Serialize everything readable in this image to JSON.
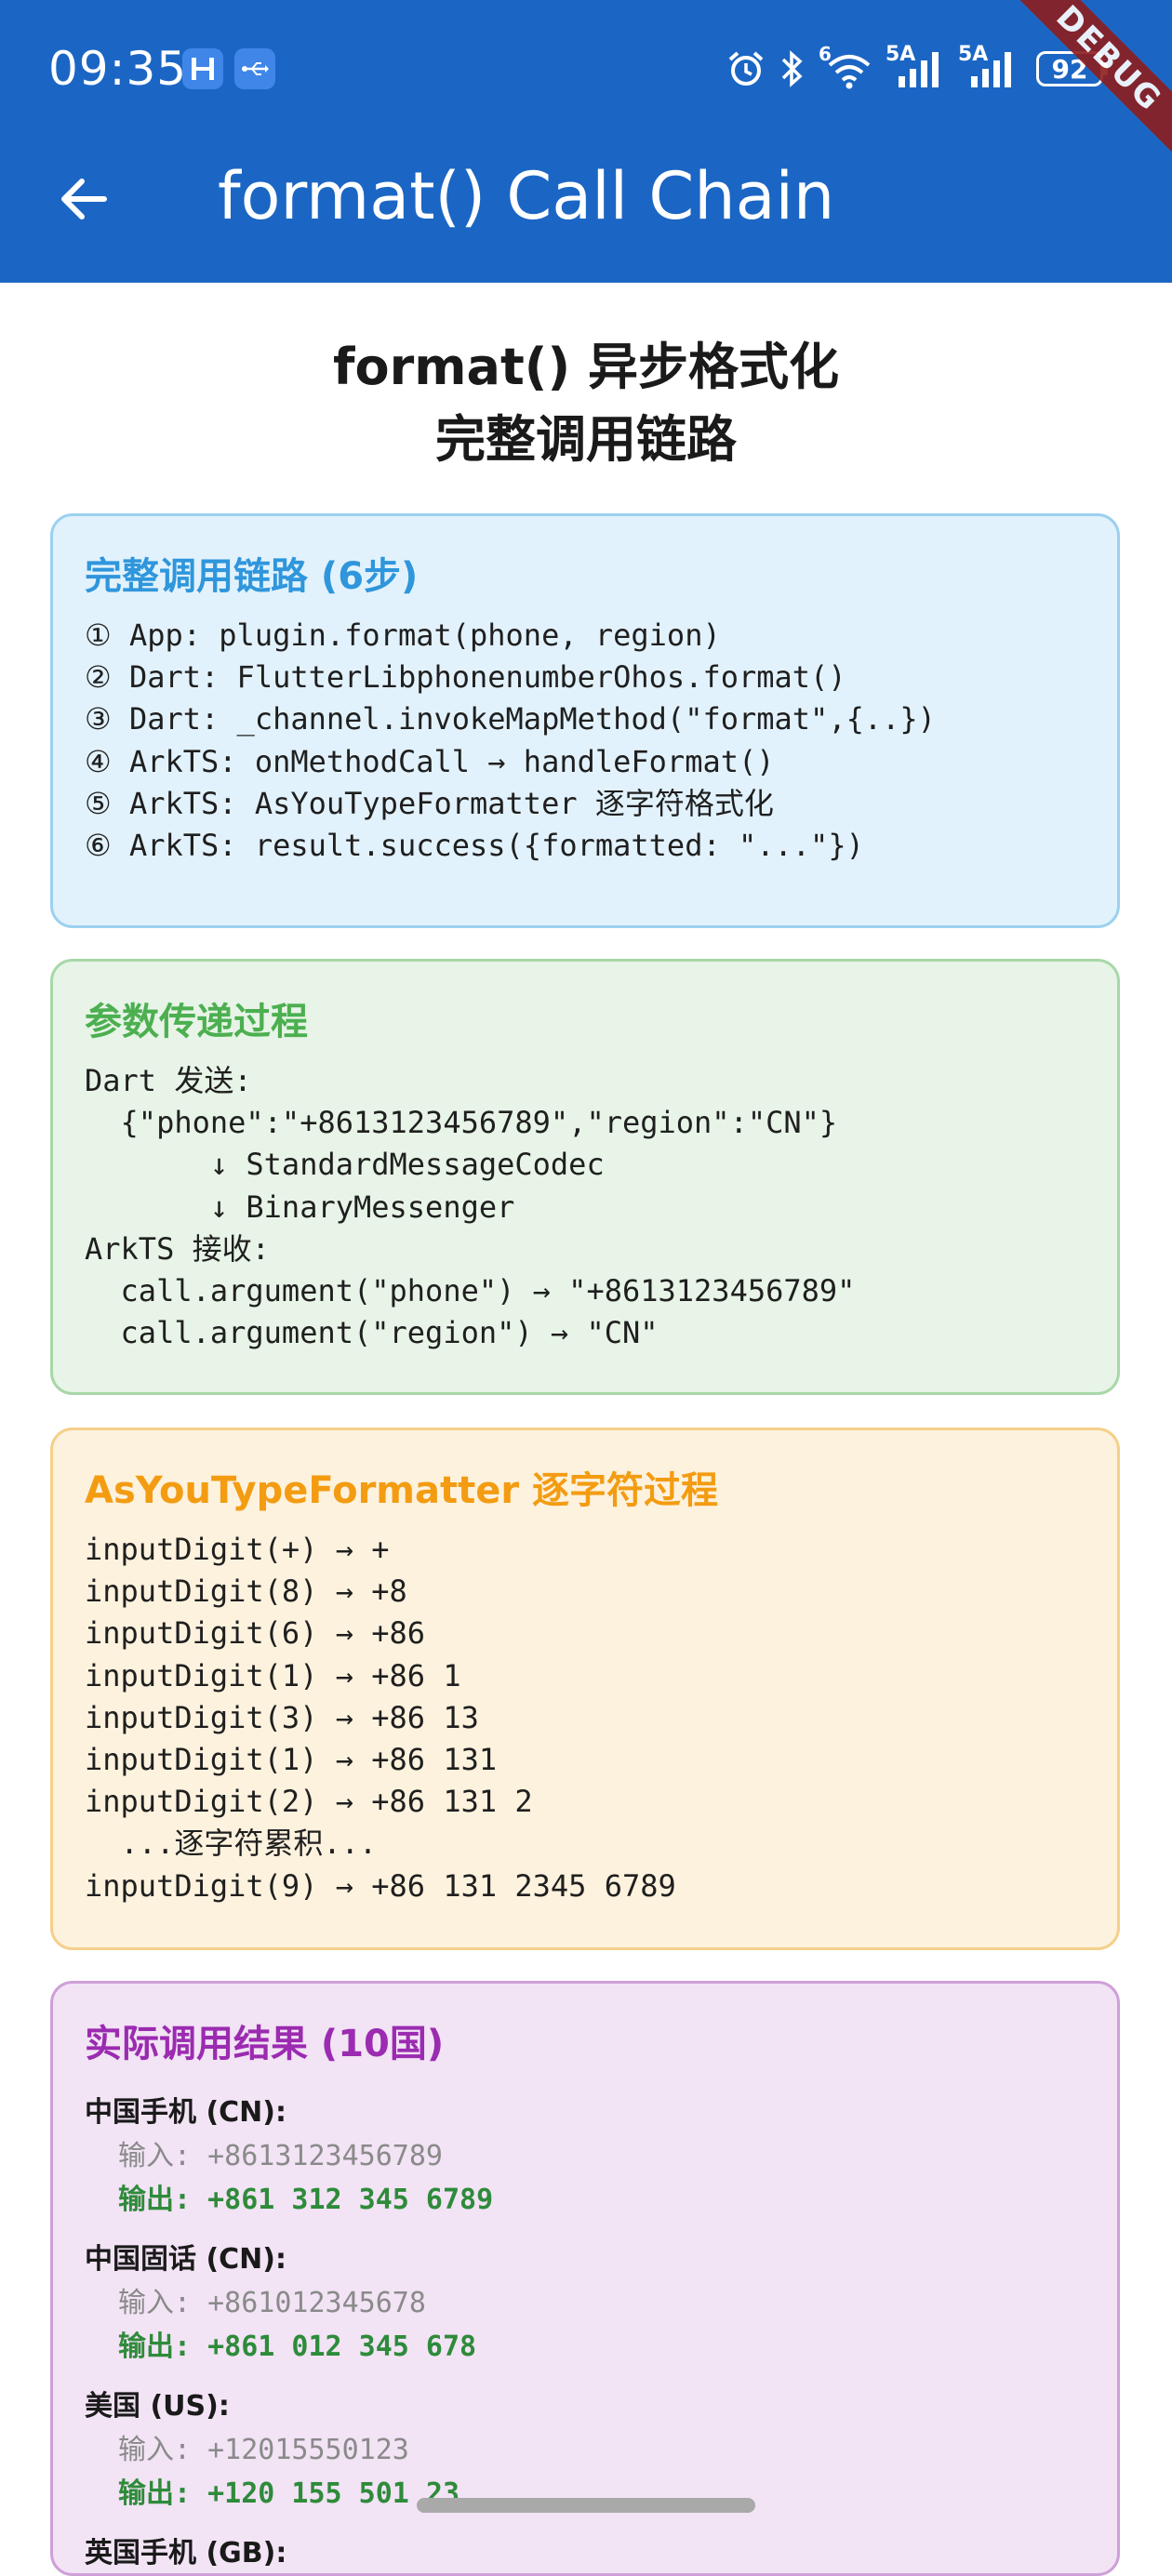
{
  "status_bar": {
    "time": "09:35",
    "signal_1_label": "5A",
    "signal_2_label": "5A",
    "wifi_label": "6",
    "battery": "92",
    "debug_banner": "DEBUG",
    "icons": [
      "harmony-app-icon",
      "usb-icon",
      "alarm-icon",
      "bluetooth-icon",
      "wifi-icon",
      "signal-icon",
      "signal-icon",
      "battery-icon"
    ]
  },
  "app_bar": {
    "title": "format() Call Chain",
    "back_icon": "arrow-back-icon"
  },
  "page_title": {
    "line1": "format() 异步格式化",
    "line2": "完整调用链路"
  },
  "call_chain_card": {
    "title": "完整调用链路 (6步)",
    "lines": [
      "① App: plugin.format(phone, region)",
      "② Dart: FlutterLibphonenumberOhos.format()",
      "③ Dart: _channel.invokeMapMethod(\"format\",{..})",
      "④ ArkTS: onMethodCall → handleFormat()",
      "⑤ ArkTS: AsYouTypeFormatter 逐字符格式化",
      "⑥ ArkTS: result.success({formatted: \"...\"})"
    ]
  },
  "params_card": {
    "title": "参数传递过程",
    "lines": [
      "Dart 发送:",
      "  {\"phone\":\"+8613123456789\",\"region\":\"CN\"}",
      "       ↓ StandardMessageCodec",
      "       ↓ BinaryMessenger",
      "ArkTS 接收:",
      "  call.argument(\"phone\") → \"+8613123456789\"",
      "  call.argument(\"region\") → \"CN\""
    ]
  },
  "formatter_card": {
    "title": "AsYouTypeFormatter 逐字符过程",
    "lines": [
      "inputDigit(+) → +",
      "inputDigit(8) → +8",
      "inputDigit(6) → +86",
      "inputDigit(1) → +86 1",
      "inputDigit(3) → +86 13",
      "inputDigit(1) → +86 131",
      "inputDigit(2) → +86 131 2",
      "  ...逐字符累积...",
      "inputDigit(9) → +86 131 2345 6789"
    ]
  },
  "results_card": {
    "title": "实际调用结果 (10国)",
    "items": [
      {
        "name": "中国手机 (CN):",
        "input": "输入: +8613123456789",
        "output": "输出: +861 312 345 6789"
      },
      {
        "name": "中国固话 (CN):",
        "input": "输入: +861012345678",
        "output": "输出: +861 012 345 678"
      },
      {
        "name": "美国 (US):",
        "input": "输入: +12015550123",
        "output": "输出: +120 155 501 23"
      },
      {
        "name": "英国手机 (GB):",
        "input": "",
        "output": ""
      }
    ]
  }
}
